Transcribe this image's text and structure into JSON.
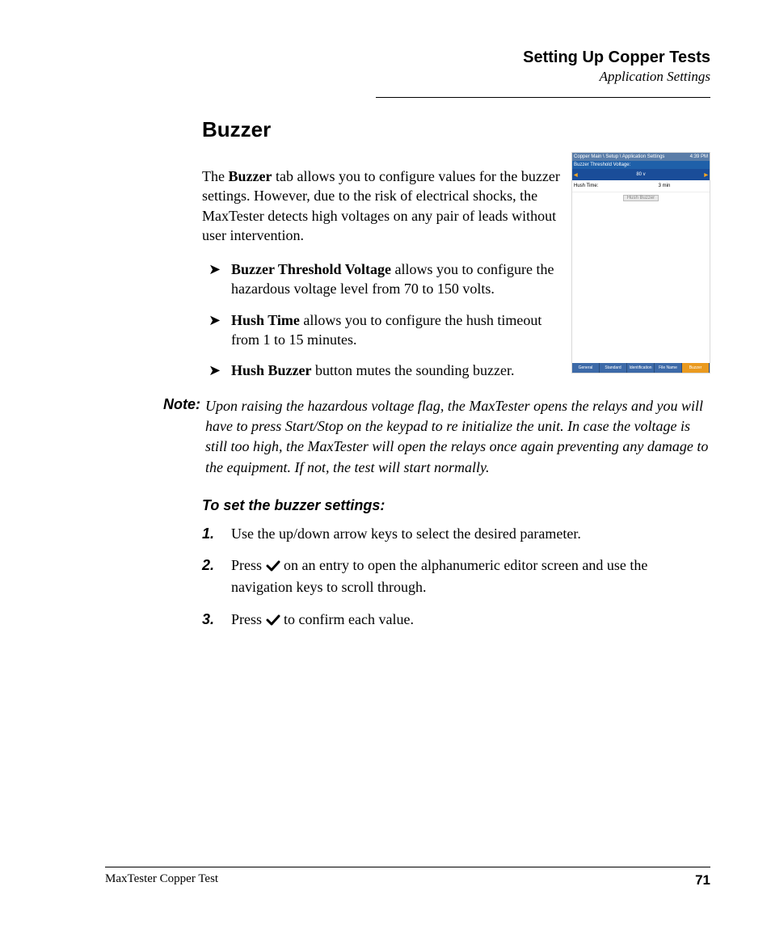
{
  "header": {
    "chapter": "Setting Up Copper Tests",
    "subtitle": "Application Settings"
  },
  "section": {
    "title": "Buzzer",
    "intro_pre": "The ",
    "intro_bold": "Buzzer",
    "intro_post": " tab allows you to configure values for the buzzer settings. However, due to the risk of electrical shocks, the MaxTester detects high voltages on any pair of leads without user intervention."
  },
  "bullets": [
    {
      "bold": "Buzzer Threshold Voltage",
      "text": " allows you to configure the hazardous voltage level from 70 to 150 volts."
    },
    {
      "bold": "Hush Time",
      "text": " allows you to configure the hush timeout from 1 to 15 minutes."
    },
    {
      "bold": "Hush Buzzer",
      "text": " button mutes the sounding buzzer."
    }
  ],
  "note": {
    "label": "Note:",
    "text": "Upon raising the hazardous voltage flag, the MaxTester opens the relays and you will have to press Start/Stop on the keypad to re initialize the unit. In case the voltage is still too high, the MaxTester will open the relays once again preventing any damage to the equipment. If not, the test will start normally."
  },
  "howto": {
    "heading": "To set the buzzer settings:",
    "steps": [
      "Use the up/down arrow keys to select the desired parameter.",
      "Press ✔ on an entry to open the alphanumeric editor screen and use the navigation keys to scroll through.",
      "Press ✔ to confirm each value."
    ]
  },
  "screenshot": {
    "breadcrumb": "Copper Main \\ Setup \\ Application Settings",
    "time": "4:39 PM",
    "field_label": "Buzzer Threshold Voltage:",
    "field_value": "80 v",
    "hush_label": "Hush Time:",
    "hush_value": "3 min",
    "button": "Hush Buzzer",
    "tabs": [
      "General",
      "Standard",
      "Identification",
      "File Name",
      "Buzzer"
    ]
  },
  "footer": {
    "left": "MaxTester Copper Test",
    "page": "71"
  }
}
